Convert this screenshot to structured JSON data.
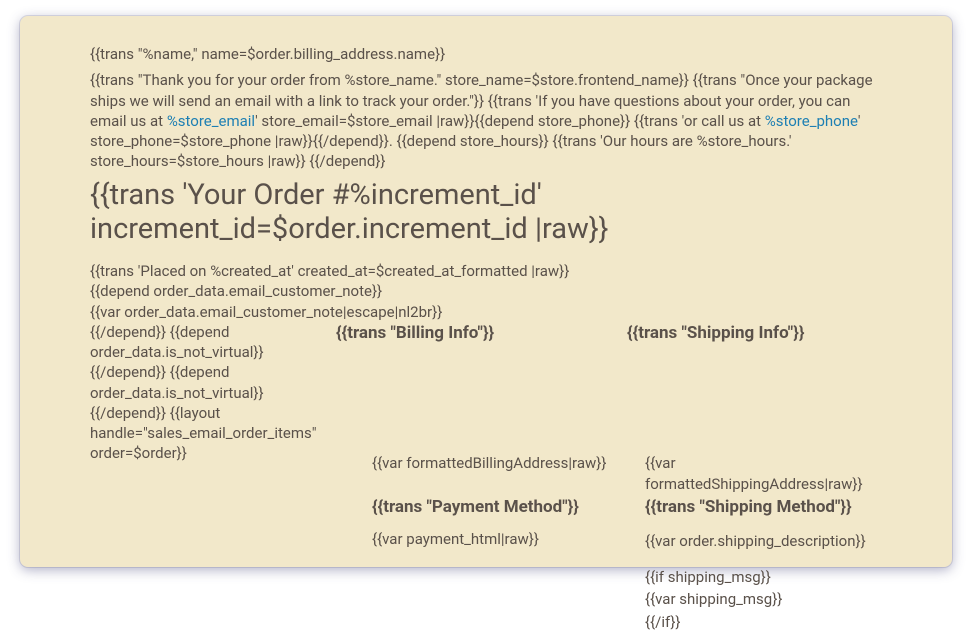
{
  "greeting": "{{trans \"%name,\" name=$order.billing_address.name}}",
  "intro": {
    "part1": "{{trans \"Thank you for your order from %store_name.\" store_name=$store.frontend_name}} {{trans \"Once your package ships we will send an email with a link to track your order.\"}} {{trans 'If you have questions about your order, you can email us at ",
    "link1": "%store_email",
    "part2": "' store_email=$store_email |raw}}{{depend store_phone}} {{trans 'or call us at ",
    "link2": "%store_phone",
    "part3": "' store_phone=$store_phone |raw}}{{/depend}}. {{depend store_hours}} {{trans 'Our hours are %store_hours.' store_hours=$store_hours |raw}} {{/depend}}"
  },
  "order_heading": "{{trans 'Your Order #%increment_id' increment_id=$order.increment_id |raw}}",
  "placed_on": "{{trans 'Placed on %created_at' created_at=$created_at_formatted |raw}}",
  "note_depend": "{{depend order_data.email_customer_note}}",
  "note_var": "{{var order_data.email_customer_note|escape|nl2br}}",
  "row1_prefix": "{{/depend}} {{depend order_data.is_not_virtual}} {{/depend}} {{depend order_data.is_not_virtual}} {{/depend}} {{layout handle=\"sales_email_order_items\" ",
  "row1_suffix": "order=$order}}",
  "billing_heading": "{{trans \"Billing Info\"}}",
  "shipping_heading": "{{trans \"Shipping Info\"}}",
  "billing_addr": "{{var formattedBillingAddress|raw}}",
  "shipping_addr": "{{var formattedShippingAddress|raw}}",
  "shipping_method_heading": "{{trans \"Shipping Method\"}}",
  "payment_method_heading": "{{trans \"Payment Method\"}}",
  "shipping_desc": "{{var order.shipping_description}}",
  "payment_html": "{{var payment_html|raw}}",
  "ship_if": "{{if shipping_msg}}",
  "ship_msg": "{{var shipping_msg}}",
  "ship_endif": "{{/if}}"
}
